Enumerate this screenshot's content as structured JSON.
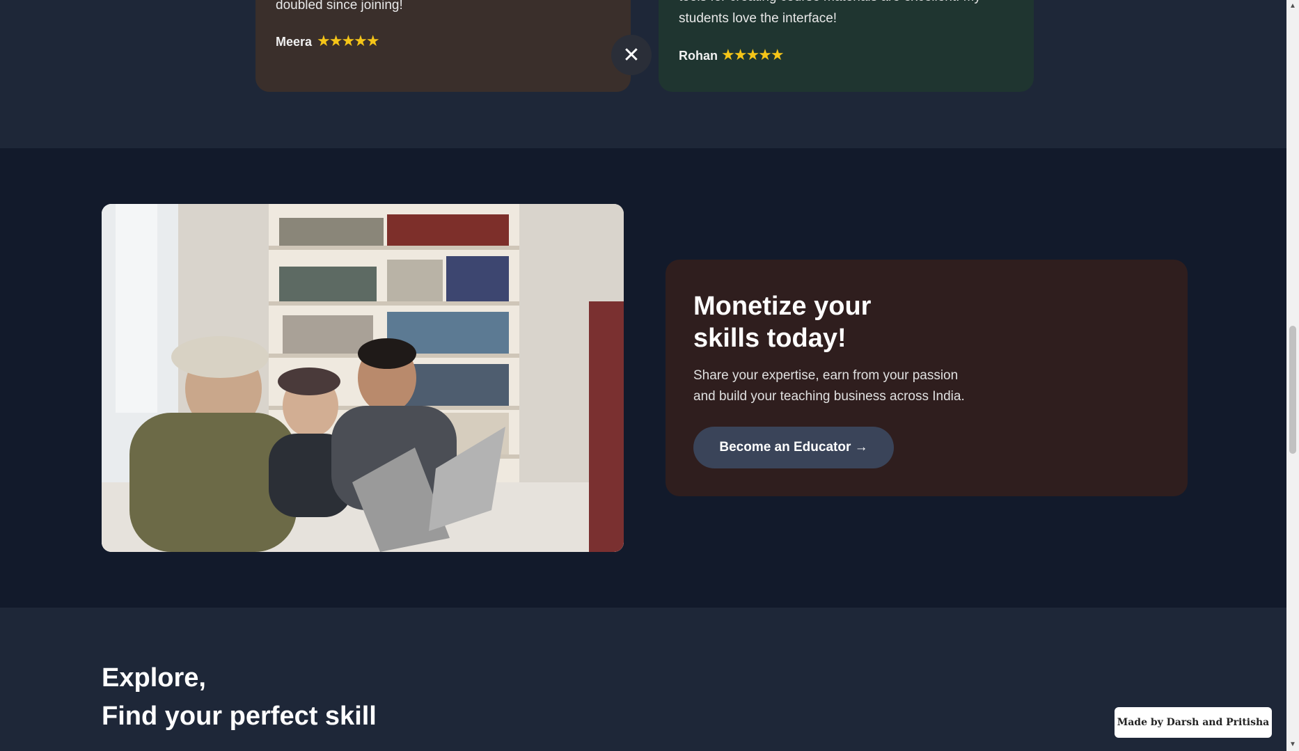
{
  "testimonials": [
    {
      "text_lines": [
        "doubled since joining!"
      ],
      "name": "Meera",
      "stars": "★★★★★"
    },
    {
      "text_lines": [
        "tools for creating course materials are excellent. My",
        "students love the interface!"
      ],
      "name": "Rohan",
      "stars": "★★★★★"
    }
  ],
  "close_icon": "✕",
  "monetize": {
    "title_line1": "Monetize your",
    "title_line2": "skills today!",
    "desc_line1": "Share your expertise, earn from your passion",
    "desc_line2": "and build your teaching business across India.",
    "button_label": "Become an Educator →"
  },
  "explore": {
    "line1": "Explore,",
    "line2": "Find your perfect skill"
  },
  "credit": "Made by Darsh and Pritisha",
  "scrollbar": {
    "up": "▲",
    "down": "▼"
  },
  "colors": {
    "band_dark": "#121a2b",
    "band_slate": "#1e2738",
    "meera_card": "#3a2f2b",
    "rohan_card": "#1f3530",
    "cta_card": "#2f1e1e",
    "cta_button": "#3a4459",
    "star": "#f5c518"
  }
}
